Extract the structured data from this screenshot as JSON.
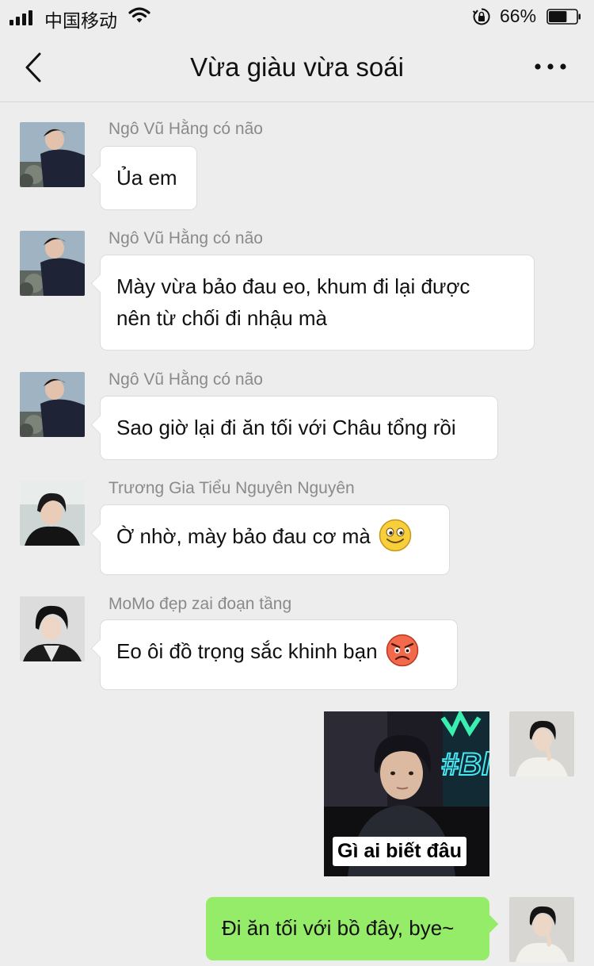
{
  "status_bar": {
    "carrier": "中国移动",
    "battery_percent": "66%",
    "battery_level": 0.66
  },
  "header": {
    "title": "Vừa giàu vừa soái"
  },
  "messages": [
    {
      "sender": "Ngô Vũ Hằng có não",
      "text": "Ủa em"
    },
    {
      "sender": "Ngô Vũ Hằng có não",
      "line1": "Mày vừa bảo đau eo, khum đi lại được",
      "line2": "nên từ chối đi nhậu mà"
    },
    {
      "sender": "Ngô Vũ Hằng có não",
      "text": "Sao giờ lại đi ăn tối với Châu tổng rồi"
    },
    {
      "sender": "Trương Gia Tiểu Nguyên Nguyên",
      "text": "Ờ nhờ, mày bảo đau cơ mà",
      "emoji": "smiling-face"
    },
    {
      "sender": "MoMo đẹp zai đoạn tầng",
      "text": "Eo ôi đồ trọng sắc khinh bạn",
      "emoji": "angry-face"
    }
  ],
  "outgoing": {
    "sticker_caption": "Gì ai biết đâu",
    "text": "Đi ăn tối với bồ đây, bye~"
  },
  "colors": {
    "background": "#ededed",
    "my_bubble": "#95ec69",
    "their_bubble": "#ffffff",
    "sender_name": "#8a8a8a"
  }
}
